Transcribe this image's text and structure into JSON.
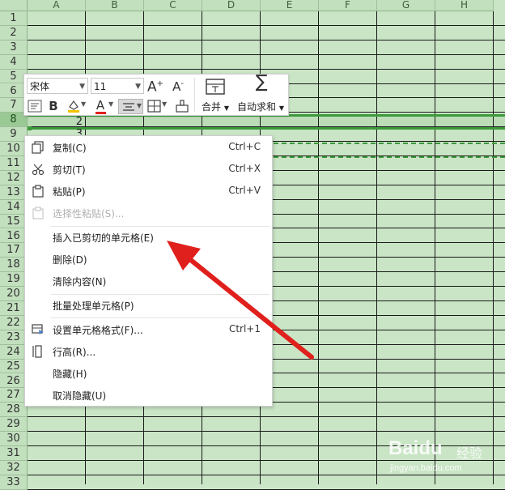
{
  "columns": [
    "A",
    "B",
    "C",
    "D",
    "E",
    "F",
    "G",
    "H"
  ],
  "rows": [
    "1",
    "2",
    "3",
    "4",
    "5",
    "6",
    "7",
    "8",
    "9",
    "10",
    "11",
    "12",
    "13",
    "14",
    "15",
    "16",
    "17",
    "18",
    "19",
    "20",
    "21",
    "22",
    "23",
    "24",
    "25",
    "26",
    "27",
    "28",
    "29",
    "30",
    "31",
    "32",
    "33"
  ],
  "selected_row": "8",
  "cells": {
    "a8": "2",
    "a9": "3"
  },
  "minibar": {
    "font_name": "宋体",
    "font_size": "11",
    "grow_font_icon": "A⁺",
    "shrink_font_icon": "A⁻",
    "merge_label": "合并",
    "autosum_label": "自动求和",
    "bold_glyph": "B",
    "font_color_glyph": "A"
  },
  "context_menu": {
    "items": [
      {
        "label": "复制(C)",
        "shortcut": "Ctrl+C",
        "icon": "copy-icon"
      },
      {
        "label": "剪切(T)",
        "shortcut": "Ctrl+X",
        "icon": "scissors-icon"
      },
      {
        "label": "粘贴(P)",
        "shortcut": "Ctrl+V",
        "icon": "clipboard-icon"
      },
      {
        "label": "选择性粘贴(S)...",
        "shortcut": "",
        "icon": "paste-special-icon",
        "disabled": true
      },
      {
        "label": "插入已剪切的单元格(E)",
        "shortcut": ""
      },
      {
        "label": "删除(D)",
        "shortcut": ""
      },
      {
        "label": "清除内容(N)",
        "shortcut": ""
      },
      {
        "label": "批量处理单元格(P)",
        "shortcut": ""
      },
      {
        "label": "设置单元格格式(F)...",
        "shortcut": "Ctrl+1",
        "icon": "format-cells-icon"
      },
      {
        "label": "行高(R)...",
        "shortcut": "",
        "icon": "row-height-icon"
      },
      {
        "label": "隐藏(H)",
        "shortcut": ""
      },
      {
        "label": "取消隐藏(U)",
        "shortcut": ""
      }
    ]
  },
  "annotation": {
    "arrow_color": "#e0201c"
  },
  "watermark": {
    "brand": "Baidu",
    "cn": "经验",
    "url": "jingyan.baidu.com"
  },
  "colors": {
    "grid_bg": "#c9e5c5",
    "selection": "#3c9a3a"
  }
}
